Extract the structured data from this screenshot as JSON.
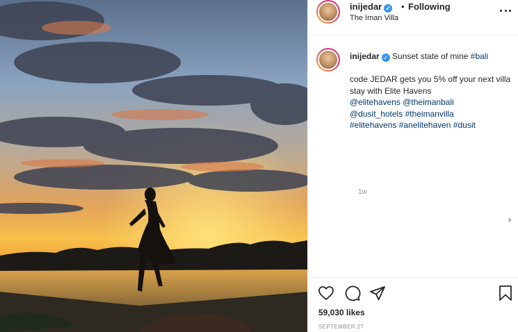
{
  "post": {
    "username": "inijedar",
    "verified_mark": "✓",
    "separator": "•",
    "follow_status": "Following",
    "location": "The Iman Villa"
  },
  "caption": {
    "username": "inijedar",
    "line1_text": "Sunset state of mine ",
    "line1_tag": "#bali",
    "line2": "code JEDAR gets you 5% off your next villa stay with Elite Havens",
    "mentions": [
      "@elitehavens",
      "@theimanbali",
      "@dusit_hotels"
    ],
    "tags_line3": "#theimanvilla",
    "tags_line4": [
      "#elitehavens",
      "#anelitehaven",
      "#dusit"
    ],
    "time_ago": "1w"
  },
  "engagement": {
    "likes": "59,030 likes",
    "date": "SEPTEMBER 27"
  },
  "icons": {
    "more": "more-options-icon",
    "like": "heart-icon",
    "comment": "comment-icon",
    "share": "share-icon",
    "save": "bookmark-icon",
    "next": "chevron-right-icon"
  },
  "colors": {
    "link": "#00376b",
    "verified": "#3897f0",
    "muted": "#8e8e8e",
    "sky_top": "#5b7ea6",
    "sunset": "#f5b13a"
  }
}
